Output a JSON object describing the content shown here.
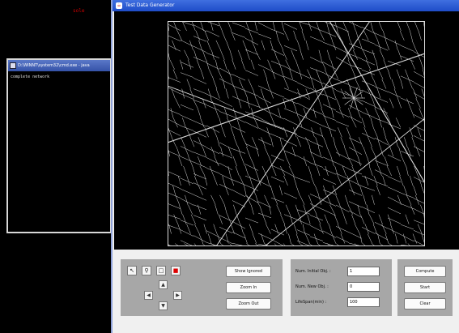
{
  "background_text": "sole",
  "console": {
    "title": "D:\\WINNT\\system32\\cmd.exe - java",
    "lines": [
      "complete network"
    ]
  },
  "window": {
    "title": "Test Data Generator"
  },
  "toolbar": {
    "tool_icons": [
      "pointer-icon",
      "magnifier-icon",
      "select-box-icon",
      "stop-icon"
    ],
    "pan_icons": [
      "arrow-up-icon",
      "arrow-left-icon",
      "arrow-right-icon",
      "arrow-down-icon"
    ]
  },
  "view": {
    "show_ignored_label": "Show Ignored",
    "zoom_in_label": "Zoom In",
    "zoom_out_label": "Zoom Out"
  },
  "params": {
    "init_obj_label": "Num. Initial Obj. :",
    "init_obj_value": "1",
    "new_obj_label": "Num. New Obj. :",
    "new_obj_value": "0",
    "lifespan_label": "LifeSpan(min) :",
    "lifespan_value": "100"
  },
  "actions": {
    "compute_label": "Compute",
    "start_label": "Start",
    "clear_label": "Clear"
  },
  "colors": {
    "titlebar": "#2454d0",
    "map_bg": "#000000",
    "road": "#dcdcdc",
    "group_panel": "#a7a7a7"
  }
}
